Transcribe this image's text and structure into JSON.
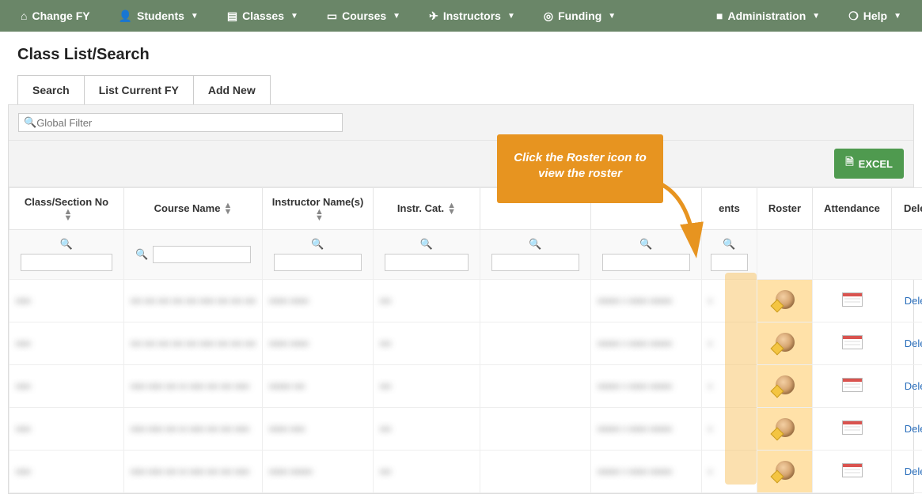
{
  "nav": {
    "change_fy": "Change FY",
    "students": "Students",
    "classes": "Classes",
    "courses": "Courses",
    "instructors": "Instructors",
    "funding": "Funding",
    "administration": "Administration",
    "help": "Help"
  },
  "page_title": "Class List/Search",
  "tabs": {
    "search": "Search",
    "list_current": "List Current FY",
    "add_new": "Add New"
  },
  "global_filter_placeholder": "Global Filter",
  "excel_label": "EXCEL",
  "columns": {
    "class_section": "Class/Section No",
    "course_name": "Course Name",
    "instructor_names": "Instructor Name(s)",
    "instr_cat": "Instr. Cat.",
    "col5": "",
    "col6": "",
    "students_partial": "ents",
    "roster": "Roster",
    "attendance": "Attendance",
    "delete": "Delete"
  },
  "callout_text": "Click the Roster icon to view the roster",
  "rows": [
    {
      "c1": "▪▪▪▪",
      "c2": "▪▪▪ ▪▪▪ ▪▪▪ ▪▪▪ ▪▪▪\n▪▪▪▪ ▪▪▪ ▪▪▪ ▪▪▪",
      "c3": "▪▪▪▪▪ ▪▪▪▪▪",
      "c4": "▪▪▪",
      "c5": "",
      "c6": "▪▪▪▪▪▪ ▪ ▪▪▪▪▪\n▪▪▪▪▪▪",
      "c7": "▪",
      "delete": "Delete"
    },
    {
      "c1": "▪▪▪▪",
      "c2": "▪▪▪ ▪▪▪ ▪▪▪ ▪▪▪ ▪▪▪\n▪▪▪▪ ▪▪▪ ▪▪▪ ▪▪▪",
      "c3": "▪▪▪▪▪ ▪▪▪▪▪",
      "c4": "▪▪▪",
      "c5": "",
      "c6": "▪▪▪▪▪▪ ▪ ▪▪▪▪▪\n▪▪▪▪▪▪",
      "c7": "▪",
      "delete": "Delete"
    },
    {
      "c1": "▪▪▪▪",
      "c2": "▪▪▪▪ ▪▪▪▪ ▪▪▪ ▪▪\n▪▪▪▪ ▪▪▪ ▪▪▪ ▪▪▪▪",
      "c3": "▪▪▪▪▪▪ ▪▪▪",
      "c4": "▪▪▪",
      "c5": "",
      "c6": "▪▪▪▪▪▪ ▪ ▪▪▪▪▪\n▪▪▪▪▪▪",
      "c7": "▪",
      "delete": "Delete"
    },
    {
      "c1": "▪▪▪▪",
      "c2": "▪▪▪▪ ▪▪▪▪ ▪▪▪ ▪▪\n▪▪▪▪ ▪▪▪ ▪▪▪ ▪▪▪▪",
      "c3": "▪▪▪▪▪ ▪▪▪▪",
      "c4": "▪▪▪",
      "c5": "",
      "c6": "▪▪▪▪▪▪ ▪ ▪▪▪▪▪\n▪▪▪▪▪▪",
      "c7": "▪",
      "delete": "Delete"
    },
    {
      "c1": "▪▪▪▪",
      "c2": "▪▪▪▪ ▪▪▪▪ ▪▪▪ ▪▪\n▪▪▪▪ ▪▪▪ ▪▪▪ ▪▪▪▪",
      "c3": "▪▪▪▪▪ ▪▪▪▪▪▪",
      "c4": "▪▪▪",
      "c5": "",
      "c6": "▪▪▪▪▪▪ ▪ ▪▪▪▪▪\n▪▪▪▪▪▪",
      "c7": "▪",
      "delete": "Delete"
    }
  ]
}
